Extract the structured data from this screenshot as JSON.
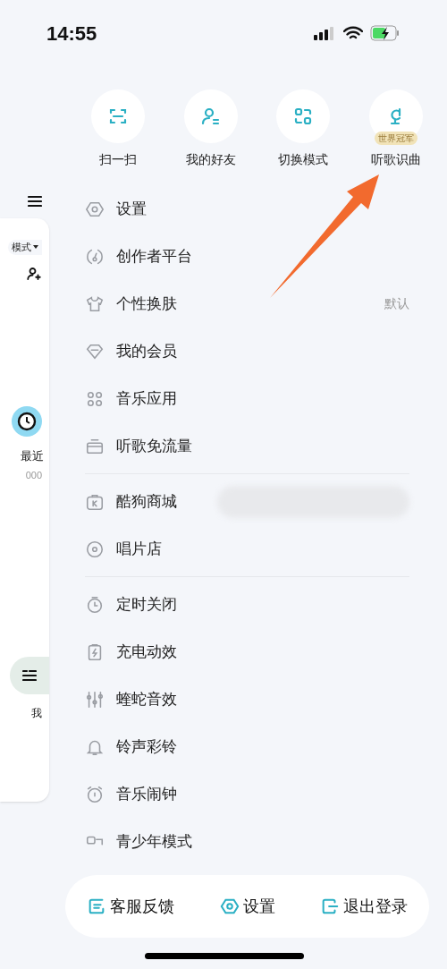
{
  "status_bar": {
    "time": "14:55"
  },
  "background_app": {
    "mode_label": "模式",
    "recent_label": "最近",
    "recent_count": "000",
    "tab_label": "我"
  },
  "quick_actions": [
    {
      "label": "扫一扫"
    },
    {
      "label": "我的好友"
    },
    {
      "label": "切换模式"
    },
    {
      "label": "听歌识曲",
      "badge": "世界冠军"
    }
  ],
  "menu_sections": [
    {
      "items": [
        {
          "label": "设置"
        },
        {
          "label": "创作者平台"
        },
        {
          "label": "个性换肤",
          "value": "默认"
        },
        {
          "label": "我的会员"
        },
        {
          "label": "音乐应用"
        },
        {
          "label": "听歌免流量"
        }
      ]
    },
    {
      "items": [
        {
          "label": "酷狗商城",
          "kind": "promo"
        },
        {
          "label": "唱片店"
        }
      ]
    },
    {
      "items": [
        {
          "label": "定时关闭"
        },
        {
          "label": "充电动效"
        },
        {
          "label": "蝰蛇音效"
        },
        {
          "label": "铃声彩铃"
        },
        {
          "label": "音乐闹钟"
        },
        {
          "label": "青少年模式"
        }
      ]
    }
  ],
  "bottom_bar": [
    {
      "label": "客服反馈"
    },
    {
      "label": "设置"
    },
    {
      "label": "退出登录"
    }
  ]
}
